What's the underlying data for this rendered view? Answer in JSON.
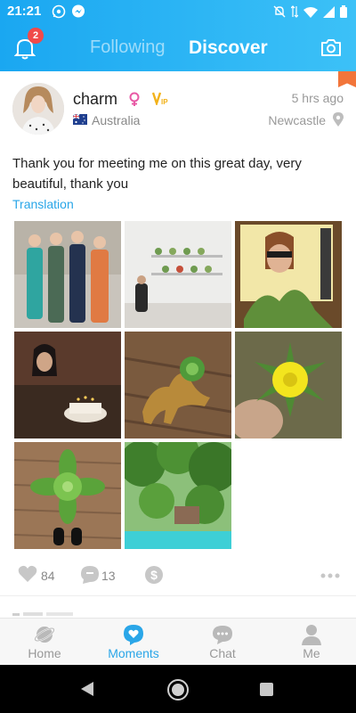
{
  "status_bar": {
    "time": "21:21",
    "icons": [
      "whatsapp-icon",
      "messenger-icon",
      "mute-icon",
      "data-arrows-icon",
      "wifi-icon",
      "signal-icon",
      "battery-icon"
    ]
  },
  "header": {
    "notification_count": "2",
    "tabs": [
      {
        "label": "Following",
        "active": false
      },
      {
        "label": "Discover",
        "active": true
      }
    ],
    "icons": {
      "left": "bell-icon",
      "right": "camera-icon"
    },
    "colors": {
      "gradient_start": "#1aa7f1",
      "gradient_end": "#3cc1f7"
    }
  },
  "post": {
    "username": "charm",
    "gender_icon": "female-icon",
    "vip_icon": "vip-icon",
    "country": "Australia",
    "country_flag": "australia-flag-icon",
    "time_ago": "5 hrs ago",
    "location": "Newcastle",
    "text": "Thank you for meeting me on this great day, very beautiful, thank you",
    "translation_label": "Translation",
    "photo_count": 8,
    "likes": "84",
    "comments": "13",
    "action_icons": [
      "heart-icon",
      "comment-icon",
      "tip-dollar-icon",
      "more-icon"
    ]
  },
  "bottom_nav": {
    "items": [
      {
        "label": "Home",
        "icon": "planet-icon",
        "active": false
      },
      {
        "label": "Moments",
        "icon": "moments-heart-bubble-icon",
        "active": true
      },
      {
        "label": "Chat",
        "icon": "chat-bubble-icon",
        "active": false
      },
      {
        "label": "Me",
        "icon": "person-icon",
        "active": false
      }
    ],
    "accent_color": "#2aa6e8"
  },
  "system_nav": [
    "back-icon",
    "home-circle-icon",
    "recent-apps-icon"
  ]
}
